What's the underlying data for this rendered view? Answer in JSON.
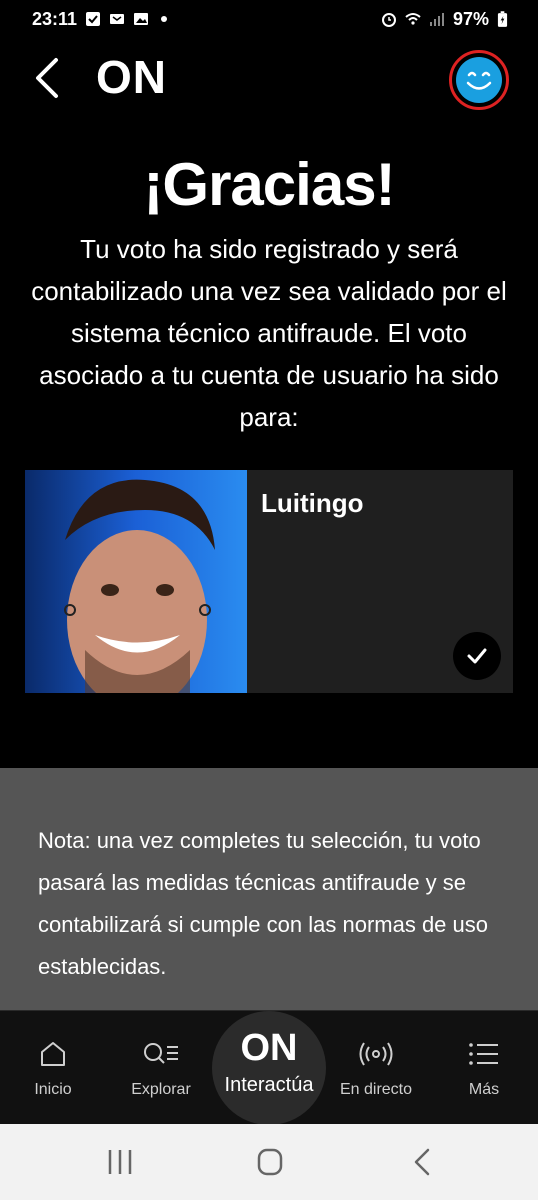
{
  "status_bar": {
    "time": "23:11",
    "battery": "97%"
  },
  "header": {
    "title": "ON"
  },
  "main": {
    "title": "¡Gracias!",
    "message": "Tu voto ha sido registrado y será contabilizado una vez sea validado por el sistema técnico antifraude. El voto asociado a tu cuenta de usuario ha sido para:"
  },
  "vote": {
    "candidate_name": "Luitingo"
  },
  "note": {
    "text": "Nota: una vez completes tu selección, tu voto pasará las medidas técnicas antifraude y se contabilizará si cumple con las normas de uso establecidas."
  },
  "bottom_nav": {
    "items": [
      {
        "label": "Inicio",
        "icon": "home-icon"
      },
      {
        "label": "Explorar",
        "icon": "search-list-icon"
      },
      {
        "label": "Interactúa",
        "logo": "ON",
        "icon": "on-logo"
      },
      {
        "label": "En directo",
        "icon": "live-broadcast-icon"
      },
      {
        "label": "Más",
        "icon": "menu-list-icon"
      }
    ]
  },
  "colors": {
    "background": "#000000",
    "note_panel": "#555555",
    "avatar_border": "#dd2222",
    "avatar_fill": "#1a9fe0",
    "photo_background": "#1a5fd0"
  }
}
